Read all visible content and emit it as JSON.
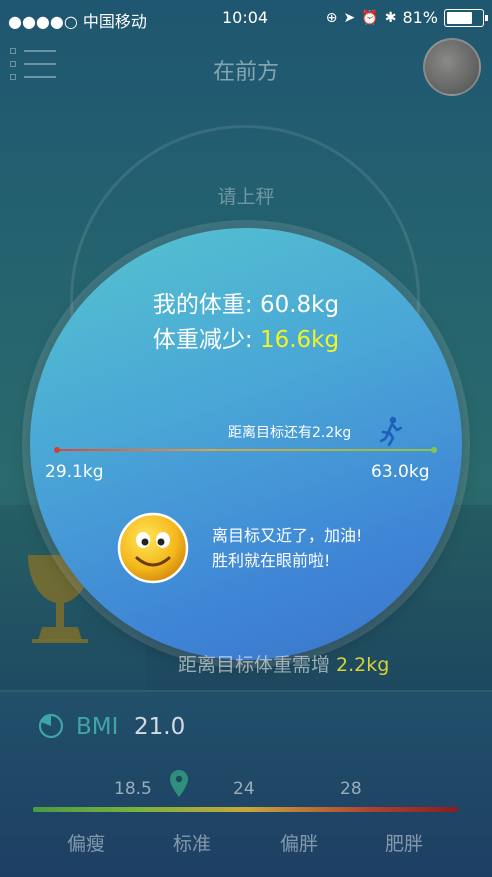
{
  "status_bar": {
    "carrier": "●●●●○ 中国移动",
    "time": "10:04",
    "battery_text": "81%",
    "battery_level": 0.81
  },
  "header": {
    "title": "在前方",
    "menu_icon": "menu-list-icon",
    "avatar_icon": "user-avatar"
  },
  "weigh": {
    "prompt": "请上秤"
  },
  "summary": {
    "weight_label": "我的体重: ",
    "weight_value": "60.8kg",
    "reduce_label": "体重减少: ",
    "reduce_value": "16.6kg",
    "reduce_color": "#f3f324"
  },
  "progress": {
    "goal_text": "距离目标还有2.2kg",
    "start_value": "29.1kg",
    "end_value": "63.0kg",
    "runner_icon": "runner-icon"
  },
  "encourage": {
    "line1": "离目标又近了，加油!",
    "line2": "胜利就在眼前啦!",
    "icon": "smiley-icon"
  },
  "need": {
    "label": "距离目标体重需增 ",
    "value": "2.2kg",
    "value_color": "#d8d13a"
  },
  "bmi": {
    "label": "BMI",
    "value": "21.0",
    "label_color": "#3ea6a6",
    "ticks": [
      "18.5",
      "24",
      "28"
    ],
    "categories": [
      "偏瘦",
      "标准",
      "偏胖",
      "肥胖"
    ]
  }
}
